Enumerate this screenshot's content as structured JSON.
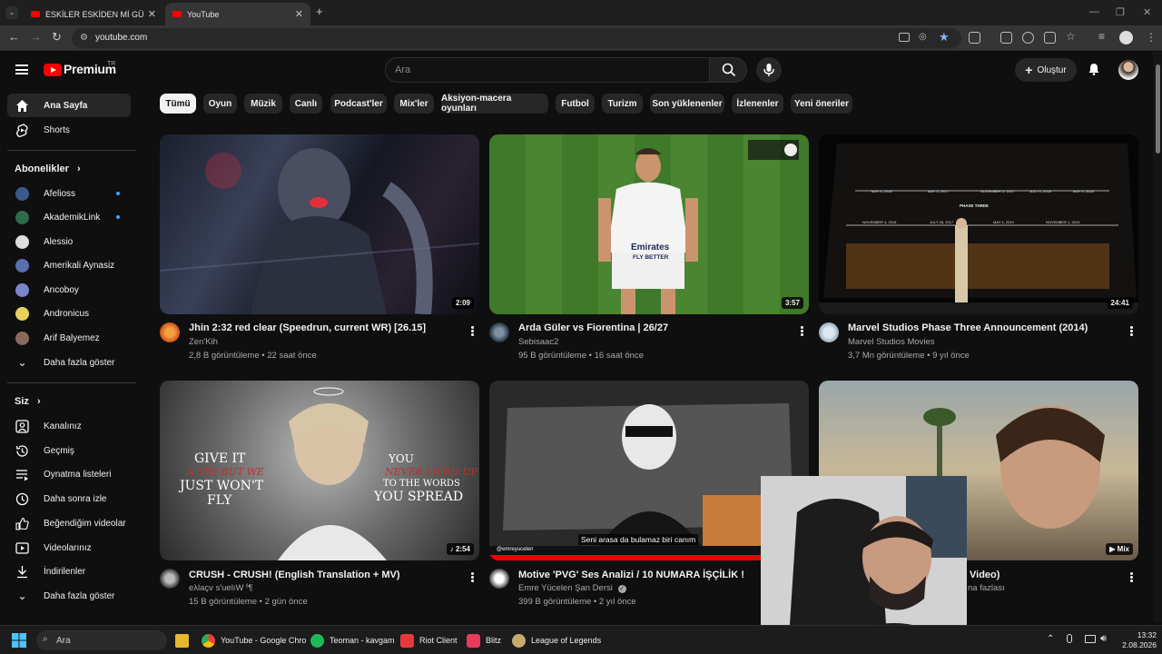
{
  "browser": {
    "tabs": [
      {
        "title": "ESKİLER ESKİDEN Mİ GÜZELDİ?",
        "active": false
      },
      {
        "title": "YouTube",
        "active": true
      }
    ],
    "new_tab": "+",
    "url": "youtube.com"
  },
  "header": {
    "brand": "Premium",
    "brand_sup": "TR",
    "search_placeholder": "Ara",
    "create_label": "Oluştur"
  },
  "sidebar": {
    "main": [
      {
        "label": "Ana Sayfa",
        "icon": "home-icon"
      },
      {
        "label": "Shorts",
        "icon": "shorts-icon"
      }
    ],
    "subs_heading": "Abonelikler",
    "subscriptions": [
      {
        "label": "Afelioss",
        "new": true,
        "color": "#3a5a8a"
      },
      {
        "label": "AkademikLink",
        "new": true,
        "color": "#2e6b4a"
      },
      {
        "label": "Alessio",
        "new": false,
        "color": "#ddd"
      },
      {
        "label": "Amerikali Aynasiz",
        "new": false,
        "color": "#5a6fb0"
      },
      {
        "label": "Ancoboy",
        "new": false,
        "color": "#7a86c9"
      },
      {
        "label": "Andronicus",
        "new": false,
        "color": "#e5d25a"
      },
      {
        "label": "Arif Balyemez",
        "new": false,
        "color": "#8a6a5a"
      }
    ],
    "show_more": "Daha fazla göster",
    "you_heading": "Siz",
    "you_items": [
      {
        "label": "Kanalınız",
        "icon": "channel-icon"
      },
      {
        "label": "Geçmiş",
        "icon": "history-icon"
      },
      {
        "label": "Oynatma listeleri",
        "icon": "playlists-icon"
      },
      {
        "label": "Daha sonra izle",
        "icon": "watch-later-icon"
      },
      {
        "label": "Beğendiğim videolar",
        "icon": "liked-icon"
      },
      {
        "label": "Videolarınız",
        "icon": "your-videos-icon"
      },
      {
        "label": "İndirilenler",
        "icon": "downloads-icon"
      },
      {
        "label": "Daha fazla göster",
        "icon": "chevron-down-icon"
      }
    ]
  },
  "chips": [
    "Tümü",
    "Oyun",
    "Müzik",
    "Canlı",
    "Podcast'ler",
    "Mix'ler",
    "Aksiyon-macera oyunları",
    "Futbol",
    "Turizm",
    "Son yüklenenler",
    "İzlenenler",
    "Yeni öneriler"
  ],
  "videos": [
    {
      "title": "Jhin 2:32 red clear (Speedrun, current WR) [26.15]",
      "channel": "Zen'Kih",
      "meta": "2,8 B görüntüleme • 22 saat önce",
      "duration": "2:09"
    },
    {
      "title": "Arda Güler vs Fiorentina | 26/27",
      "channel": "Sebisaac2",
      "meta": "95 B görüntüleme • 16 saat önce",
      "duration": "3:57"
    },
    {
      "title": "Marvel Studios Phase Three Announcement (2014)",
      "channel": "Marvel Studios Movies",
      "meta": "3,7 Mn görüntüleme • 9 yıl önce",
      "duration": "24:41"
    },
    {
      "title": "CRUSH - CRUSH! (English Translation + MV)",
      "channel": "eλlaçv s'uelıW ᶠ¶",
      "meta": "15 B görüntüleme • 2 gün önce",
      "duration": "2:54"
    },
    {
      "title": "Motive 'PVG' Ses Analizi / 10 NUMARA İŞÇİLİK !",
      "channel": "Emre Yücelen Şan Dersi",
      "meta": "399 B görüntüleme • 2 yıl önce",
      "duration": ""
    },
    {
      "title": "Video)",
      "channel": "na fazlası",
      "meta": "",
      "duration": "Mix"
    }
  ],
  "thumb_text": {
    "marvel_dates": [
      "MAY 6, 2016",
      "MAY 5, 2017",
      "NOVEMBER 3, 2017",
      "JULY 6, 2018",
      "MAY 4, 2018",
      "NOVEMBER 4, 2016",
      "JULY 28, 2017",
      "MAY 4, 2019",
      "NOVEMBER 1, 2019"
    ],
    "marvel_phase": "PHASE THREE",
    "crush_left": [
      "GIVE IT",
      "A TRY BUT WE",
      "JUST WON'T",
      "FLY"
    ],
    "crush_right": [
      "YOU",
      "NEVER LIVED UP",
      "TO THE WORDS",
      "YOU SPREAD"
    ],
    "motive_caption": "Seni arasa da bulamaz biri canım",
    "motive_tag": "@emreyucelen",
    "jersey_line1": "Emirates",
    "jersey_line2": "FLY BETTER"
  },
  "taskbar": {
    "search": "Ara",
    "apps": [
      {
        "label": "YouTube - Google Chro",
        "color": "#4285f4"
      },
      {
        "label": "Teoman - kavgam",
        "color": "#1db954"
      },
      {
        "label": "Riot Client",
        "color": "#e8393a"
      },
      {
        "label": "Blitz",
        "color": "#e83a5a"
      },
      {
        "label": "League of Legends",
        "color": "#c8aa6e"
      }
    ],
    "time": "13:32",
    "date": "2.08.2026"
  }
}
